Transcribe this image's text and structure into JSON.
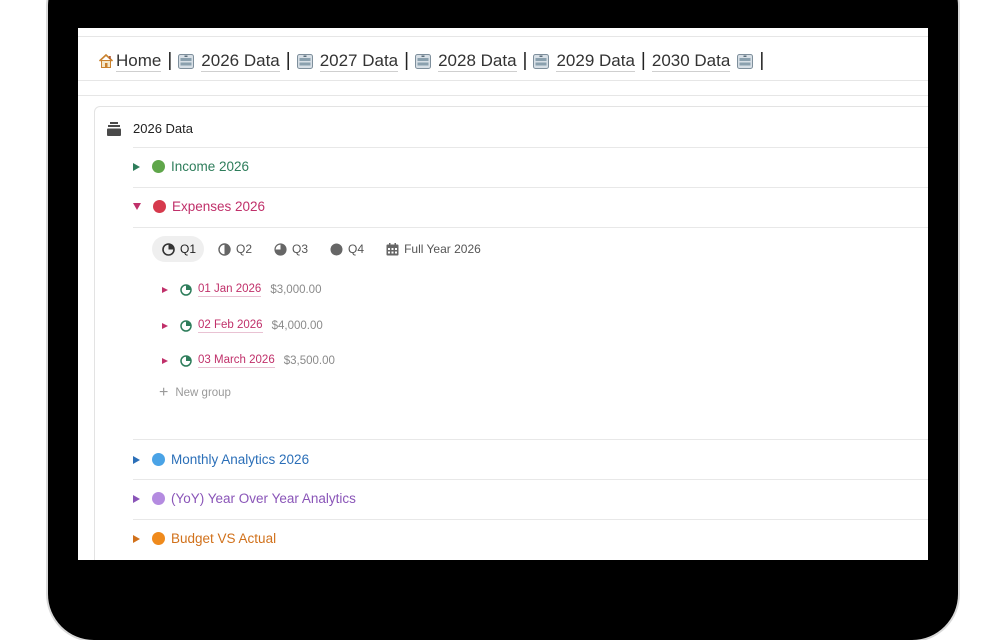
{
  "nav": {
    "items": [
      {
        "label": "Home",
        "icon": "house-icon"
      },
      {
        "label": "2026 Data",
        "icon": "database-icon"
      },
      {
        "label": "2027 Data",
        "icon": "database-icon"
      },
      {
        "label": "2028 Data",
        "icon": "database-icon"
      },
      {
        "label": "2029 Data",
        "icon": "database-icon"
      },
      {
        "label": "2030 Data",
        "icon": "database-icon"
      }
    ],
    "separator": "|"
  },
  "card": {
    "title": "2026 Data",
    "sections": [
      {
        "label": "Income 2026",
        "color": "#5fa64a",
        "text_color": "#2e7d5b",
        "expanded": false
      },
      {
        "label": "Expenses 2026",
        "color": "#d63a4d",
        "text_color": "#c0306a",
        "expanded": true
      },
      {
        "label": "Monthly Analytics 2026",
        "color": "#4aa3e6",
        "text_color": "#2b6fb8",
        "expanded": false
      },
      {
        "label": "(YoY) Year Over Year Analytics",
        "color": "#b48be0",
        "text_color": "#8a55b8",
        "expanded": false
      },
      {
        "label": "Budget VS Actual",
        "color": "#ef8a1c",
        "text_color": "#d1711b",
        "expanded": false
      }
    ]
  },
  "tabs": [
    {
      "label": "Q1",
      "icon": "quarter-pie-icon",
      "active": true
    },
    {
      "label": "Q2",
      "icon": "half-pie-icon",
      "active": false
    },
    {
      "label": "Q3",
      "icon": "three-quarter-pie-icon",
      "active": false
    },
    {
      "label": "Q4",
      "icon": "full-circle-icon",
      "active": false
    },
    {
      "label": "Full Year 2026",
      "icon": "calendar-icon",
      "active": false
    }
  ],
  "groups": [
    {
      "label": "01 Jan 2026",
      "amount": "$3,000.00"
    },
    {
      "label": "02 Feb 2026",
      "amount": "$4,000.00"
    },
    {
      "label": "03 March 2026",
      "amount": "$3,500.00"
    }
  ],
  "new_group_label": "New group",
  "colors": {
    "expense_accent": "#c0306a",
    "group_icon": "#2e7d5b"
  }
}
